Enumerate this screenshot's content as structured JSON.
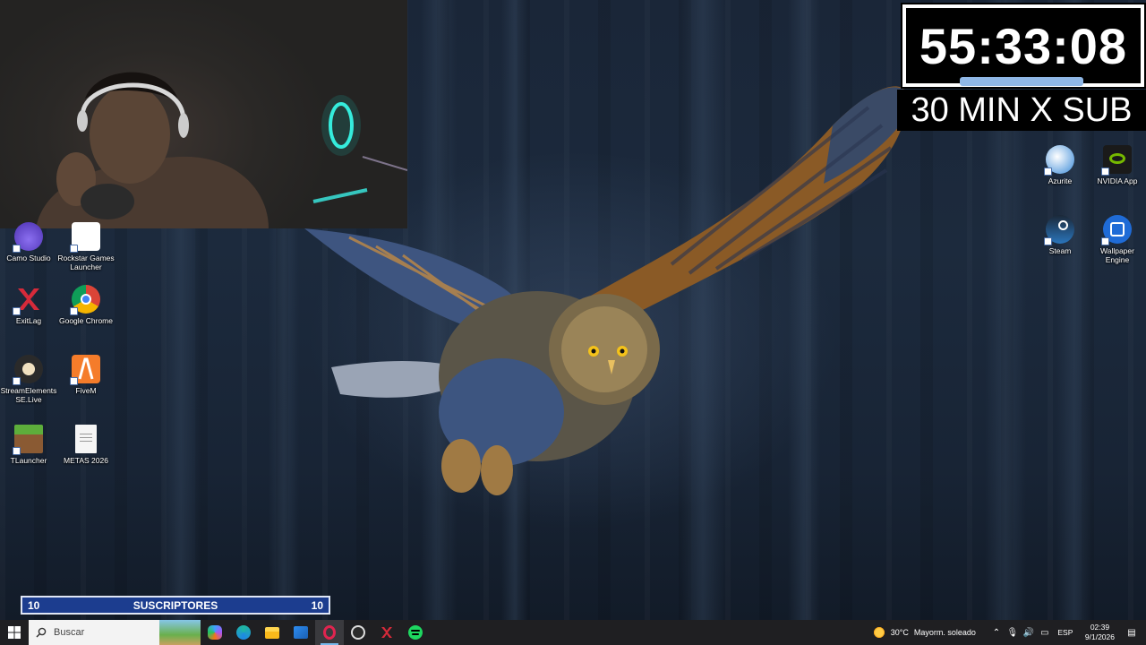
{
  "timer": {
    "value": "55:33:08",
    "subtitle": "30 MIN X SUB"
  },
  "subscribers": {
    "left_count": "10",
    "label": "SUSCRIPTORES",
    "right_count": "10"
  },
  "desktop_icons": {
    "left": [
      {
        "label": "Camo Studio",
        "icon": "camo-icon"
      },
      {
        "label": "Rockstar Games Launcher",
        "icon": "rockstar-icon"
      },
      {
        "label": "ExitLag",
        "icon": "exitlag-icon"
      },
      {
        "label": "Google Chrome",
        "icon": "chrome-icon"
      },
      {
        "label": "StreamElements SE.Live",
        "icon": "streamelements-icon"
      },
      {
        "label": "FiveM",
        "icon": "fivem-icon"
      },
      {
        "label": "TLauncher",
        "icon": "tlauncher-icon"
      },
      {
        "label": "METAS 2026",
        "icon": "text-file-icon"
      }
    ],
    "right": [
      {
        "label": "Azurite",
        "icon": "azurite-icon"
      },
      {
        "label": "NVIDIA App",
        "icon": "nvidia-icon"
      },
      {
        "label": "Steam",
        "icon": "steam-icon"
      },
      {
        "label": "Wallpaper Engine",
        "icon": "wallpaper-engine-icon"
      }
    ]
  },
  "taskbar": {
    "search_placeholder": "Buscar",
    "apps": [
      "copilot-icon",
      "edge-icon",
      "file-explorer-icon",
      "mail-icon",
      "opera-gx-icon",
      "obs-icon",
      "exitlag-icon",
      "spotify-icon"
    ],
    "active_app": "opera-gx-icon",
    "weather": {
      "temp": "30°C",
      "condition": "Mayorm. soleado"
    },
    "language": "ESP",
    "time": "02:39",
    "date": "9/1/2026"
  },
  "colors": {
    "accent": "#76b9ed",
    "subbar_bg": "#1c3d8f",
    "timer_bar": "#8fb7e6"
  }
}
